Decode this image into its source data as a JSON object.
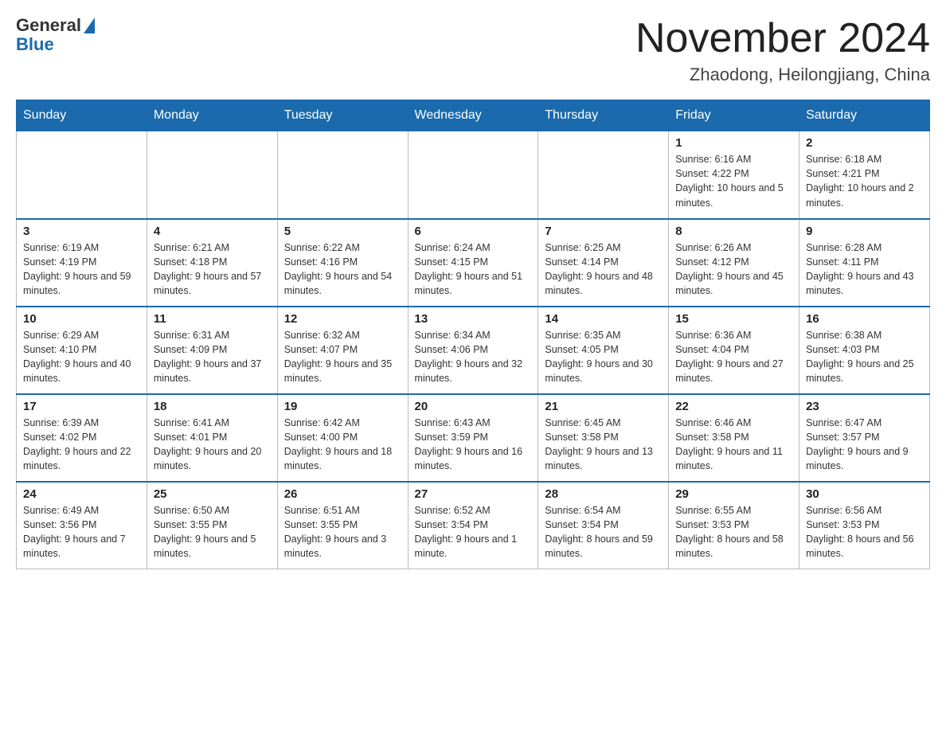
{
  "header": {
    "logo_general": "General",
    "logo_blue": "Blue",
    "month_title": "November 2024",
    "location": "Zhaodong, Heilongjiang, China"
  },
  "days_of_week": [
    "Sunday",
    "Monday",
    "Tuesday",
    "Wednesday",
    "Thursday",
    "Friday",
    "Saturday"
  ],
  "weeks": [
    [
      {
        "day": "",
        "info": ""
      },
      {
        "day": "",
        "info": ""
      },
      {
        "day": "",
        "info": ""
      },
      {
        "day": "",
        "info": ""
      },
      {
        "day": "",
        "info": ""
      },
      {
        "day": "1",
        "info": "Sunrise: 6:16 AM\nSunset: 4:22 PM\nDaylight: 10 hours and 5 minutes."
      },
      {
        "day": "2",
        "info": "Sunrise: 6:18 AM\nSunset: 4:21 PM\nDaylight: 10 hours and 2 minutes."
      }
    ],
    [
      {
        "day": "3",
        "info": "Sunrise: 6:19 AM\nSunset: 4:19 PM\nDaylight: 9 hours and 59 minutes."
      },
      {
        "day": "4",
        "info": "Sunrise: 6:21 AM\nSunset: 4:18 PM\nDaylight: 9 hours and 57 minutes."
      },
      {
        "day": "5",
        "info": "Sunrise: 6:22 AM\nSunset: 4:16 PM\nDaylight: 9 hours and 54 minutes."
      },
      {
        "day": "6",
        "info": "Sunrise: 6:24 AM\nSunset: 4:15 PM\nDaylight: 9 hours and 51 minutes."
      },
      {
        "day": "7",
        "info": "Sunrise: 6:25 AM\nSunset: 4:14 PM\nDaylight: 9 hours and 48 minutes."
      },
      {
        "day": "8",
        "info": "Sunrise: 6:26 AM\nSunset: 4:12 PM\nDaylight: 9 hours and 45 minutes."
      },
      {
        "day": "9",
        "info": "Sunrise: 6:28 AM\nSunset: 4:11 PM\nDaylight: 9 hours and 43 minutes."
      }
    ],
    [
      {
        "day": "10",
        "info": "Sunrise: 6:29 AM\nSunset: 4:10 PM\nDaylight: 9 hours and 40 minutes."
      },
      {
        "day": "11",
        "info": "Sunrise: 6:31 AM\nSunset: 4:09 PM\nDaylight: 9 hours and 37 minutes."
      },
      {
        "day": "12",
        "info": "Sunrise: 6:32 AM\nSunset: 4:07 PM\nDaylight: 9 hours and 35 minutes."
      },
      {
        "day": "13",
        "info": "Sunrise: 6:34 AM\nSunset: 4:06 PM\nDaylight: 9 hours and 32 minutes."
      },
      {
        "day": "14",
        "info": "Sunrise: 6:35 AM\nSunset: 4:05 PM\nDaylight: 9 hours and 30 minutes."
      },
      {
        "day": "15",
        "info": "Sunrise: 6:36 AM\nSunset: 4:04 PM\nDaylight: 9 hours and 27 minutes."
      },
      {
        "day": "16",
        "info": "Sunrise: 6:38 AM\nSunset: 4:03 PM\nDaylight: 9 hours and 25 minutes."
      }
    ],
    [
      {
        "day": "17",
        "info": "Sunrise: 6:39 AM\nSunset: 4:02 PM\nDaylight: 9 hours and 22 minutes."
      },
      {
        "day": "18",
        "info": "Sunrise: 6:41 AM\nSunset: 4:01 PM\nDaylight: 9 hours and 20 minutes."
      },
      {
        "day": "19",
        "info": "Sunrise: 6:42 AM\nSunset: 4:00 PM\nDaylight: 9 hours and 18 minutes."
      },
      {
        "day": "20",
        "info": "Sunrise: 6:43 AM\nSunset: 3:59 PM\nDaylight: 9 hours and 16 minutes."
      },
      {
        "day": "21",
        "info": "Sunrise: 6:45 AM\nSunset: 3:58 PM\nDaylight: 9 hours and 13 minutes."
      },
      {
        "day": "22",
        "info": "Sunrise: 6:46 AM\nSunset: 3:58 PM\nDaylight: 9 hours and 11 minutes."
      },
      {
        "day": "23",
        "info": "Sunrise: 6:47 AM\nSunset: 3:57 PM\nDaylight: 9 hours and 9 minutes."
      }
    ],
    [
      {
        "day": "24",
        "info": "Sunrise: 6:49 AM\nSunset: 3:56 PM\nDaylight: 9 hours and 7 minutes."
      },
      {
        "day": "25",
        "info": "Sunrise: 6:50 AM\nSunset: 3:55 PM\nDaylight: 9 hours and 5 minutes."
      },
      {
        "day": "26",
        "info": "Sunrise: 6:51 AM\nSunset: 3:55 PM\nDaylight: 9 hours and 3 minutes."
      },
      {
        "day": "27",
        "info": "Sunrise: 6:52 AM\nSunset: 3:54 PM\nDaylight: 9 hours and 1 minute."
      },
      {
        "day": "28",
        "info": "Sunrise: 6:54 AM\nSunset: 3:54 PM\nDaylight: 8 hours and 59 minutes."
      },
      {
        "day": "29",
        "info": "Sunrise: 6:55 AM\nSunset: 3:53 PM\nDaylight: 8 hours and 58 minutes."
      },
      {
        "day": "30",
        "info": "Sunrise: 6:56 AM\nSunset: 3:53 PM\nDaylight: 8 hours and 56 minutes."
      }
    ]
  ]
}
